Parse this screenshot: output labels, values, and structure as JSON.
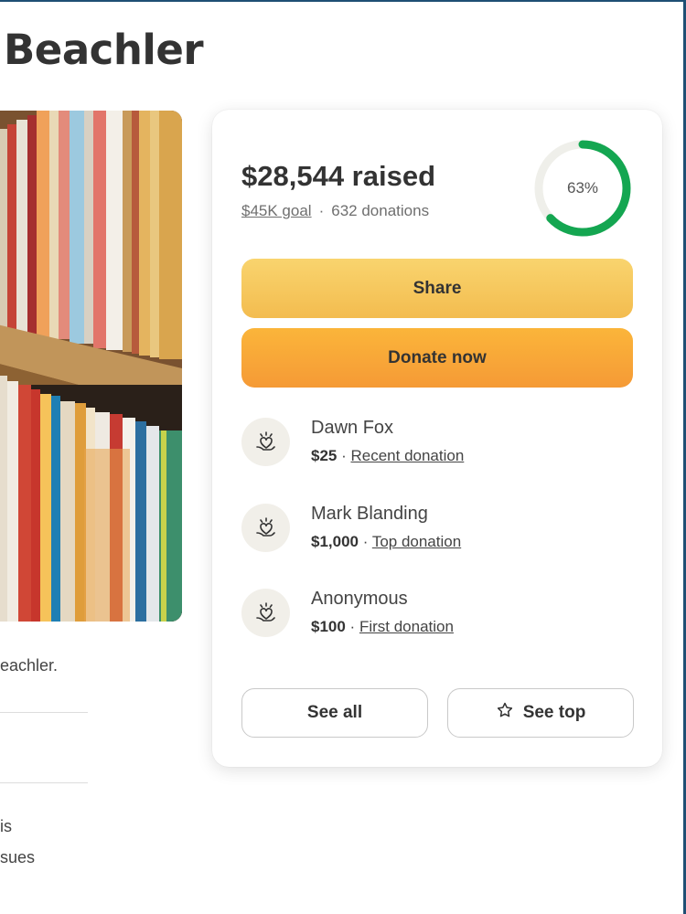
{
  "page": {
    "title": "Beachler",
    "description_fragment": "eachler.",
    "text_fragment_1": "is",
    "text_fragment_2": "sues"
  },
  "fundraiser": {
    "raised_amount": "$28,544",
    "raised_suffix": " raised",
    "goal_label": "$45K goal",
    "separator": "·",
    "donations_count": "632 donations",
    "progress_fraction": 0.63,
    "progress_label": "63%",
    "accent_color": "#14a651"
  },
  "actions": {
    "share_label": "Share",
    "donate_label": "Donate now",
    "see_all_label": "See all",
    "see_top_label": "See top"
  },
  "donors": [
    {
      "name": "Dawn Fox",
      "amount": "$25",
      "tag": "Recent donation"
    },
    {
      "name": "Mark Blanding",
      "amount": "$1,000",
      "tag": "Top donation"
    },
    {
      "name": "Anonymous",
      "amount": "$100",
      "tag": "First donation"
    }
  ],
  "icons": {
    "donor_avatar": "heart-hand-icon",
    "see_top": "star-outline-icon",
    "progress": "progress-ring-icon"
  }
}
